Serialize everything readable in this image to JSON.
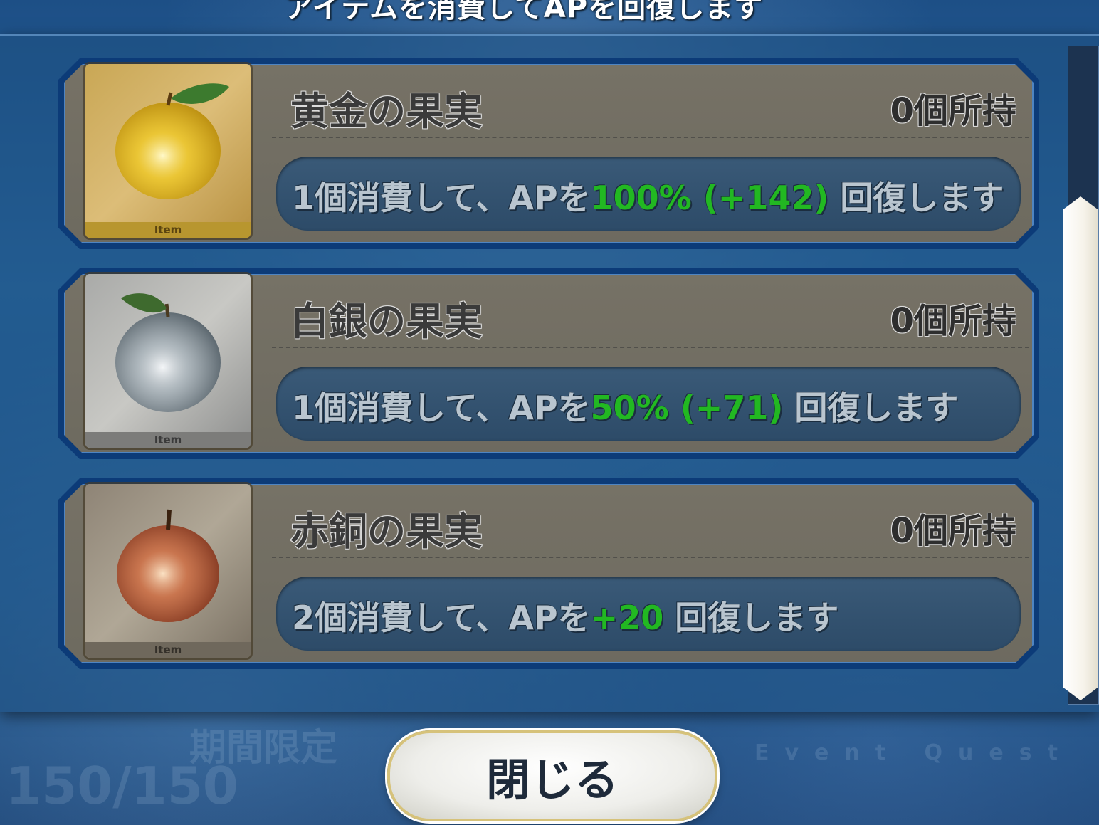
{
  "title": "アイテムを消費してAPを回復します",
  "items": [
    {
      "name": "黄金の果実",
      "count": "0個所持",
      "tag": "Item",
      "desc_pre": "1個消費して、APを",
      "desc_hl": "100% (+142)",
      "desc_post": " 回復します",
      "variant": "gold",
      "fruit_color": "#e9c32d"
    },
    {
      "name": "白銀の果実",
      "count": "0個所持",
      "tag": "Item",
      "desc_pre": "1個消費して、APを",
      "desc_hl": "50% (+71)",
      "desc_post": " 回復します",
      "variant": "silver",
      "fruit_color": "#9aa6ad"
    },
    {
      "name": "赤銅の果実",
      "count": "0個所持",
      "tag": "Item",
      "desc_pre": "2個消費して、APを",
      "desc_hl": "+20",
      "desc_post": " 回復します",
      "variant": "bronze",
      "fruit_color": "#c0694a"
    }
  ],
  "close_label": "閉じる",
  "background": {
    "ap_display": "150/150",
    "limited_label": "期間限定",
    "event_label": "Event Quest"
  },
  "colors": {
    "highlight": "#22b822",
    "card_border": "#0c3b78"
  }
}
